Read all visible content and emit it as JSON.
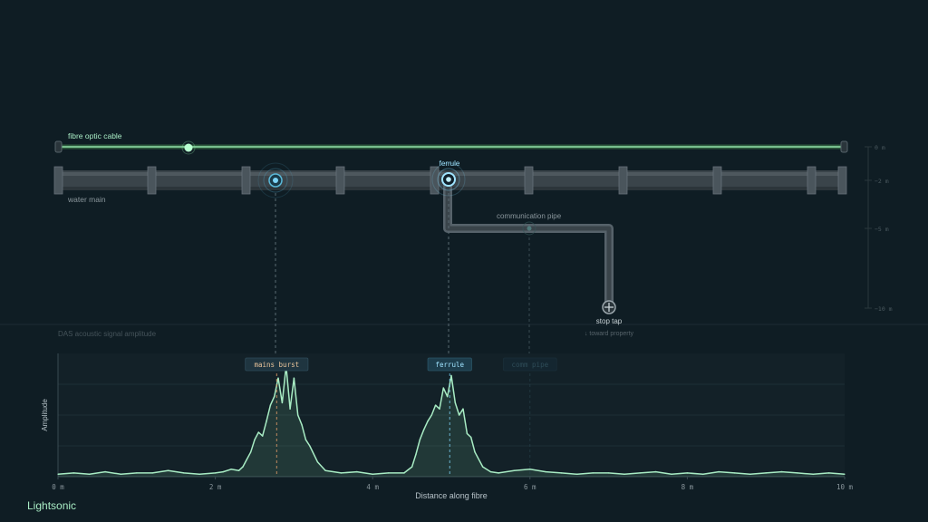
{
  "labels": {
    "fibre_cable": "fibre optic cable",
    "water_main": "water main",
    "ferrule": "ferrule",
    "comm_pipe": "communication pipe",
    "stop_tap": "stop tap",
    "toward_property": "↓ toward property",
    "section_title": "DAS acoustic signal amplitude"
  },
  "depth_scale": {
    "ticks": [
      "0 m",
      "−2 m",
      "−5 m",
      "−10 m"
    ]
  },
  "chart_data": {
    "type": "line",
    "title": "DAS acoustic signal amplitude",
    "xlabel": "Distance along fibre",
    "ylabel": "Amplitude",
    "xlim": [
      0,
      10
    ],
    "ylim": [
      0,
      1
    ],
    "x_ticks": [
      "0 m",
      "2 m",
      "4 m",
      "6 m",
      "8 m",
      "10 m"
    ],
    "grid": true,
    "annotations": [
      {
        "label": "mains burst",
        "x": 2.78,
        "style": "active-orange"
      },
      {
        "label": "ferrule",
        "x": 4.98,
        "style": "active-blue"
      },
      {
        "label": "comm pipe",
        "x": 6.0,
        "style": "faded"
      }
    ],
    "x": [
      0.0,
      0.2,
      0.4,
      0.6,
      0.8,
      1.0,
      1.2,
      1.4,
      1.6,
      1.8,
      2.0,
      2.1,
      2.2,
      2.3,
      2.35,
      2.4,
      2.45,
      2.5,
      2.55,
      2.6,
      2.65,
      2.7,
      2.75,
      2.8,
      2.85,
      2.9,
      2.95,
      3.0,
      3.05,
      3.1,
      3.15,
      3.2,
      3.3,
      3.4,
      3.6,
      3.8,
      4.0,
      4.2,
      4.4,
      4.5,
      4.55,
      4.6,
      4.65,
      4.7,
      4.75,
      4.8,
      4.85,
      4.9,
      4.95,
      5.0,
      5.05,
      5.1,
      5.15,
      5.2,
      5.25,
      5.3,
      5.4,
      5.5,
      5.6,
      5.8,
      6.0,
      6.2,
      6.4,
      6.6,
      6.8,
      7.0,
      7.2,
      7.4,
      7.6,
      7.8,
      8.0,
      8.2,
      8.4,
      8.6,
      8.8,
      9.0,
      9.2,
      9.4,
      9.6,
      9.8,
      10.0
    ],
    "values": [
      0.02,
      0.03,
      0.02,
      0.04,
      0.02,
      0.03,
      0.03,
      0.05,
      0.03,
      0.02,
      0.03,
      0.04,
      0.06,
      0.05,
      0.08,
      0.14,
      0.2,
      0.3,
      0.36,
      0.33,
      0.45,
      0.58,
      0.65,
      0.8,
      0.6,
      0.9,
      0.55,
      0.8,
      0.5,
      0.42,
      0.3,
      0.25,
      0.12,
      0.05,
      0.03,
      0.04,
      0.02,
      0.03,
      0.03,
      0.08,
      0.18,
      0.3,
      0.38,
      0.45,
      0.5,
      0.58,
      0.55,
      0.72,
      0.65,
      0.82,
      0.6,
      0.5,
      0.55,
      0.35,
      0.32,
      0.2,
      0.08,
      0.04,
      0.03,
      0.05,
      0.06,
      0.04,
      0.03,
      0.02,
      0.03,
      0.03,
      0.02,
      0.03,
      0.04,
      0.02,
      0.03,
      0.02,
      0.04,
      0.03,
      0.02,
      0.03,
      0.04,
      0.03,
      0.02,
      0.03,
      0.02
    ]
  },
  "brand": "Lightsonic",
  "colors": {
    "background": "#0f1d24",
    "fibre": "#8fe0a8",
    "signal": "#a8ecc4",
    "ferrule": "#7dd3f5",
    "burst": "#e8a06a",
    "pipe": "#4a555c"
  }
}
